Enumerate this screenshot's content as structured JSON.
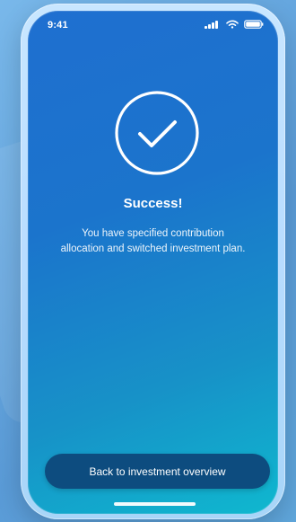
{
  "status_bar": {
    "time": "9:41"
  },
  "success": {
    "icon_name": "check-circle-icon",
    "title": "Success!",
    "message": "You have specified contribution\nallocation and switched investment plan."
  },
  "actions": {
    "back_button_label": "Back to investment overview"
  },
  "colors": {
    "screen_gradient_start": "#1f6fd0",
    "screen_gradient_end": "#0fb8cf",
    "button_background": "#0d4c7f",
    "text_primary": "#ffffff"
  }
}
